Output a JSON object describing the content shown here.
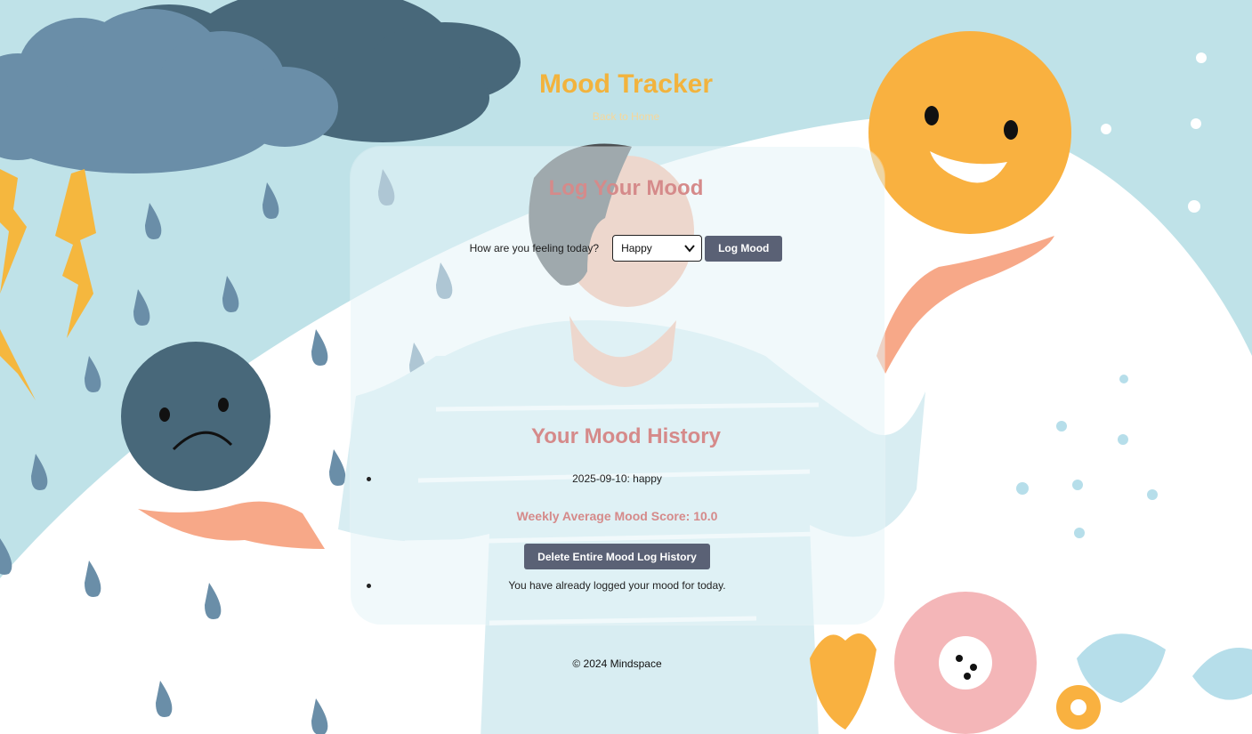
{
  "header": {
    "title": "Mood Tracker",
    "back_link": "Back to Home"
  },
  "log_section": {
    "title": "Log Your Mood",
    "question_label": "How are you feeling today?",
    "selected_mood": "Happy",
    "submit_label": "Log Mood"
  },
  "history_section": {
    "title": "Your Mood History",
    "entries": [
      "2025-09-10: happy"
    ],
    "weekly_average": "Weekly Average Mood Score: 10.0",
    "delete_label": "Delete Entire Mood Log History",
    "status_message": "You have already logged your mood for today."
  },
  "footer": {
    "copyright": "© 2024 Mindspace"
  },
  "colors": {
    "accent": "#f2b33d",
    "heading_pink": "#d58a8a",
    "button": "#5a6175",
    "background": "#bfe2e8"
  }
}
